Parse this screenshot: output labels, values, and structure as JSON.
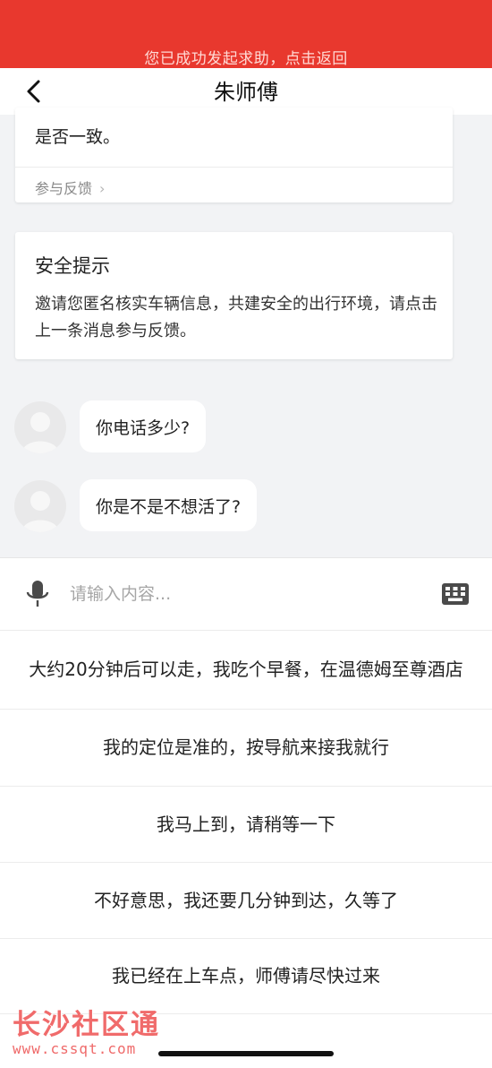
{
  "banner": {
    "text": "您已成功发起求助，点击返回"
  },
  "navbar": {
    "title": "朱师傅",
    "back_icon": "chevron-left-icon"
  },
  "card_partial": {
    "text": "是否一致。",
    "feedback_label": "参与反馈",
    "feedback_chevron": "›"
  },
  "safety_card": {
    "title": "安全提示",
    "body": "邀请您匿名核实车辆信息，共建安全的出行环境，请点击上一条消息参与反馈。"
  },
  "messages": [
    {
      "text": "你电话多少?"
    },
    {
      "text": "你是不是不想活了?"
    }
  ],
  "input": {
    "placeholder": "请输入内容...",
    "mic_icon": "microphone-icon",
    "keyboard_icon": "keyboard-icon"
  },
  "quick_replies": [
    "大约20分钟后可以走，我吃个早餐，在温德姆至尊酒店",
    "我的定位是准的，按导航来接我就行",
    "我马上到，请稍等一下",
    "不好意思，我还要几分钟到达，久等了",
    "我已经在上车点，师傅请尽快过来"
  ],
  "watermark": {
    "brand": "长沙社区通",
    "url": "www.cssqt.com"
  },
  "colors": {
    "banner": "#e8382e",
    "background": "#f2f3f5"
  }
}
